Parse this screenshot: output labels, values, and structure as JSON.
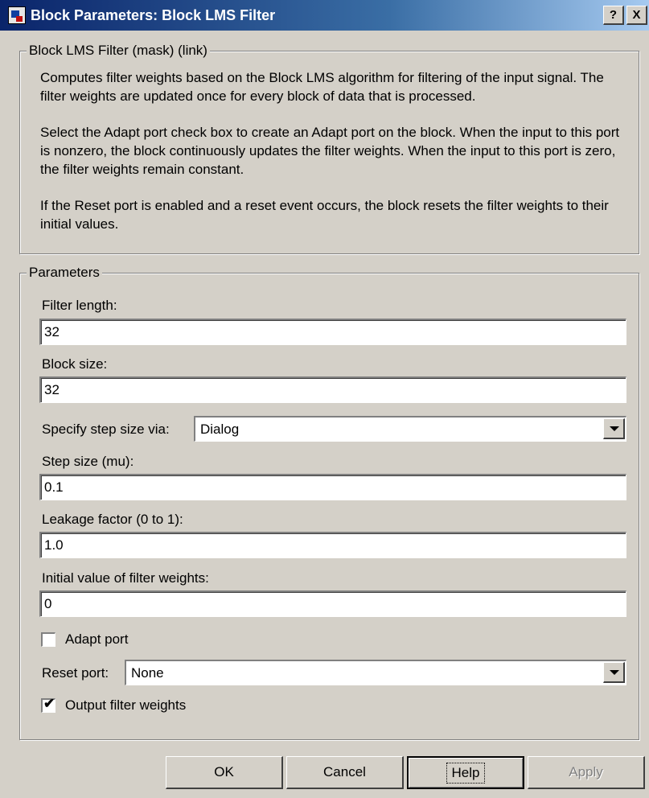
{
  "window": {
    "title": "Block Parameters: Block LMS Filter",
    "help_glyph": "?",
    "close_glyph": "X"
  },
  "description": {
    "legend": "Block LMS Filter (mask) (link)",
    "paragraphs": [
      "Computes filter weights based on the Block LMS algorithm for filtering of the input signal. The filter weights are updated once for every block of data that is processed.",
      "Select the Adapt port check box to create an Adapt port on the block. When the input to this port is nonzero, the block continuously updates the filter weights. When the input to this port is zero, the filter weights remain constant.",
      "If the Reset port is enabled and a reset event occurs, the block resets the filter weights to their initial values."
    ]
  },
  "parameters": {
    "legend": "Parameters",
    "filter_length": {
      "label": "Filter length:",
      "value": "32"
    },
    "block_size": {
      "label": "Block size:",
      "value": "32"
    },
    "step_size_via": {
      "label": "Specify step size via:",
      "value": "Dialog"
    },
    "step_size": {
      "label": "Step size (mu):",
      "value": "0.1"
    },
    "leakage": {
      "label": "Leakage factor (0 to 1):",
      "value": "1.0"
    },
    "initial_weights": {
      "label": "Initial value of filter weights:",
      "value": "0"
    },
    "adapt_port": {
      "label": "Adapt port",
      "checked": false
    },
    "reset_port": {
      "label": "Reset port:",
      "value": "None"
    },
    "output_weights": {
      "label": "Output filter weights",
      "checked": true,
      "mark": "✔"
    }
  },
  "buttons": {
    "ok": "OK",
    "cancel": "Cancel",
    "help": "Help",
    "apply": "Apply"
  }
}
